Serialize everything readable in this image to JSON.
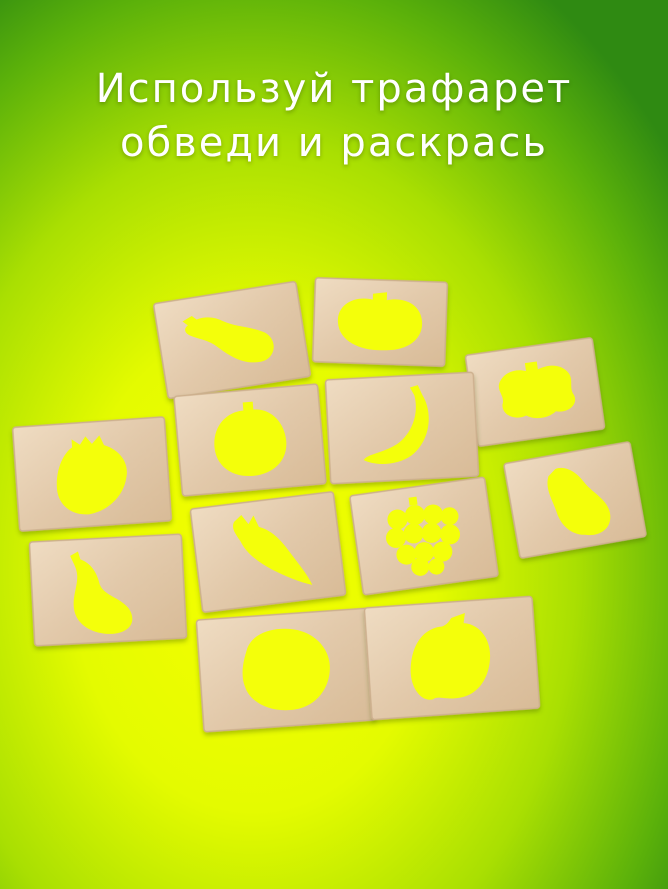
{
  "headline": {
    "line1": "Используй трафарет",
    "line2": "обведи и раскрась"
  },
  "colors": {
    "background_center": "#f2ff00",
    "background_mid": "#b8e800",
    "background_edge": "#2f8a12",
    "wood": "#e6cfb2",
    "wood_dark": "#c9a988",
    "cutout": "#f4ff0a"
  },
  "stencils": [
    {
      "shape": "eggplant-icon"
    },
    {
      "shape": "pumpkin-icon"
    },
    {
      "shape": "bell-pepper-icon"
    },
    {
      "shape": "strawberry-icon"
    },
    {
      "shape": "tomato-icon"
    },
    {
      "shape": "banana-icon"
    },
    {
      "shape": "pear-icon"
    },
    {
      "shape": "gourd-icon"
    },
    {
      "shape": "carrot-icon"
    },
    {
      "shape": "grapes-icon"
    },
    {
      "shape": "lemon-icon"
    },
    {
      "shape": "apple-icon"
    }
  ]
}
